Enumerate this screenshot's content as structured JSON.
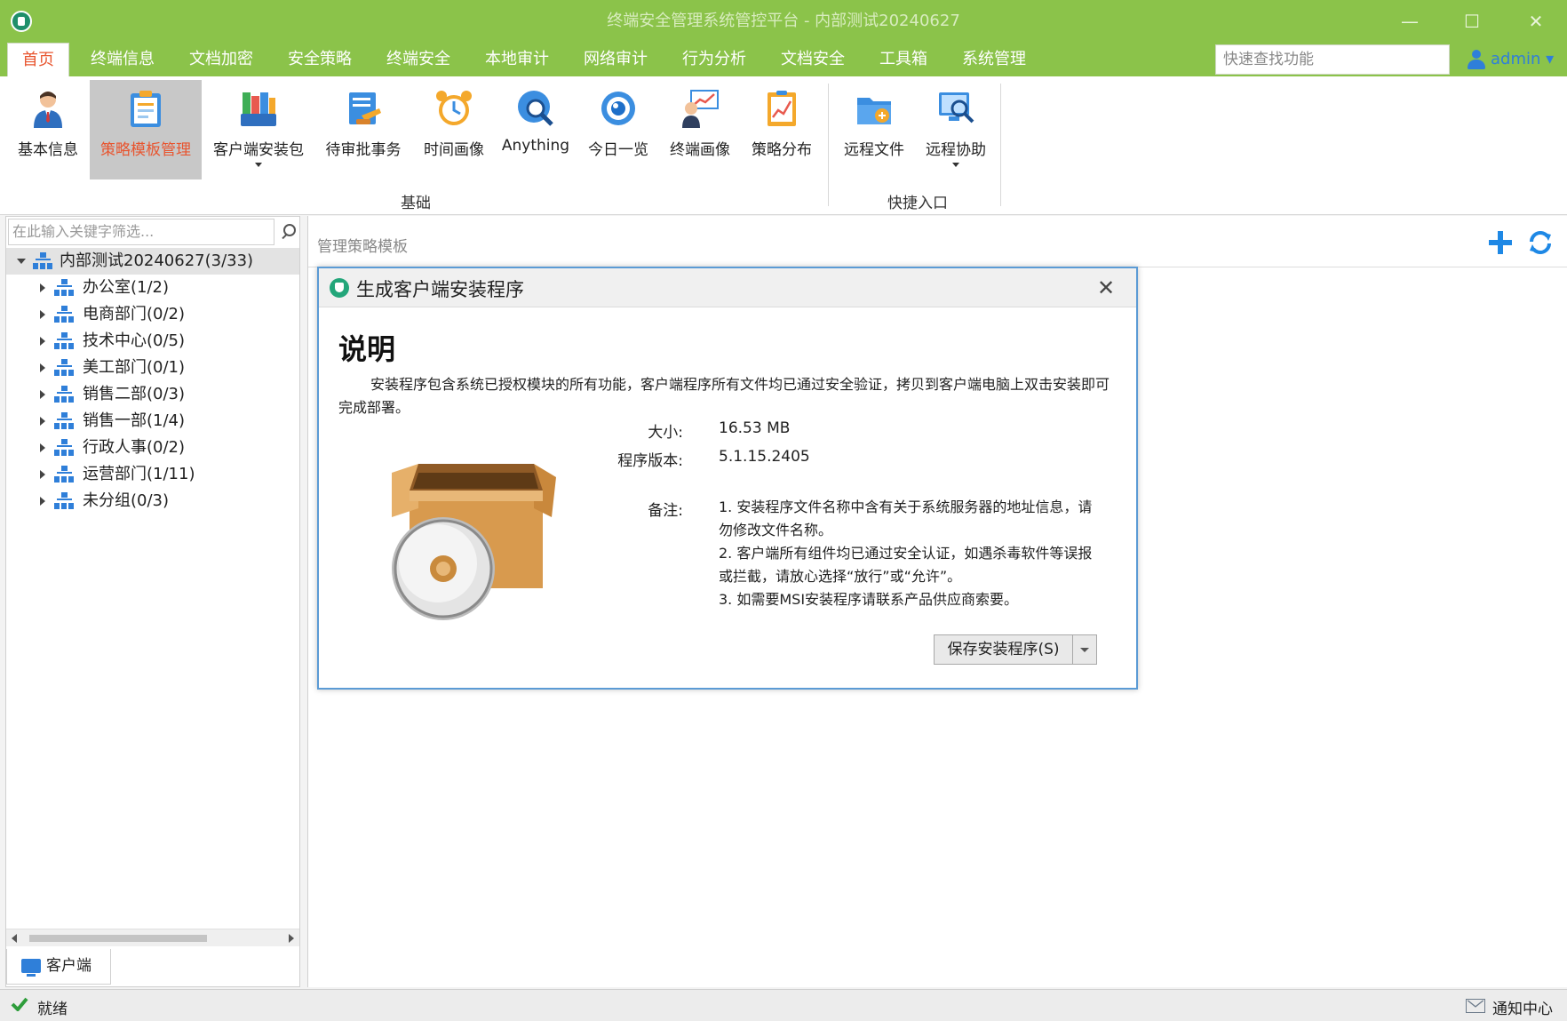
{
  "window": {
    "title": "终端安全管理系统管控平台 - 内部测试20240627",
    "min_glyph": "—",
    "max_glyph": "☐",
    "close_glyph": "✕"
  },
  "menu": {
    "tabs": [
      "首页",
      "终端信息",
      "文档加密",
      "安全策略",
      "终端安全",
      "本地审计",
      "网络审计",
      "行为分析",
      "文档安全",
      "工具箱",
      "系统管理"
    ],
    "active_index": 0,
    "quick_search_placeholder": "快速查找功能",
    "user": "admin ▾"
  },
  "ribbon": {
    "buttons": [
      {
        "label": "基本信息",
        "icon": "person-icon"
      },
      {
        "label": "策略模板管理",
        "icon": "clipboard-icon"
      },
      {
        "label": "客户端安装包",
        "icon": "package-icon"
      },
      {
        "label": "待审批事务",
        "icon": "approval-icon"
      },
      {
        "label": "时间画像",
        "icon": "clock-icon"
      },
      {
        "label": "Anything",
        "icon": "globe-search-icon"
      },
      {
        "label": "今日一览",
        "icon": "eye-icon"
      },
      {
        "label": "终端画像",
        "icon": "user-chart-icon"
      },
      {
        "label": "策略分布",
        "icon": "chart-icon"
      },
      {
        "label": "远程文件",
        "icon": "folder-icon"
      },
      {
        "label": "远程协助",
        "icon": "remote-assist-icon"
      }
    ],
    "groups": [
      "基础",
      "快捷入口"
    ],
    "active_index": 1
  },
  "tree": {
    "filter_placeholder": "在此输入关键字筛选...",
    "root": "内部测试20240627(3/33)",
    "items": [
      "办公室(1/2)",
      "电商部门(0/2)",
      "技术中心(0/5)",
      "美工部门(0/1)",
      "销售二部(0/3)",
      "销售一部(1/4)",
      "行政人事(0/2)",
      "运营部门(1/11)",
      "未分组(0/3)"
    ],
    "bottom_tab": "客户端"
  },
  "content": {
    "title": "管理策略模板"
  },
  "dialog": {
    "title": "生成客户端安装程序",
    "close": "✕",
    "heading": "说明",
    "description": "安装程序包含系统已授权模块的所有功能，客户端程序所有文件均已通过安全验证，拷贝到客户端电脑上双击安装即可完成部署。",
    "size_label": "大小:",
    "size_value": "16.53 MB",
    "version_label": "程序版本:",
    "version_value": "5.1.15.2405",
    "notes_label": "备注:",
    "notes": [
      "1. 安装程序文件名称中含有关于系统服务器的地址信息，请勿修改文件名称。",
      "2. 客户端所有组件均已通过安全认证，如遇杀毒软件等误报或拦截，请放心选择“放行”或“允许”。",
      "3. 如需要MSI安装程序请联系产品供应商索要。"
    ],
    "save_button": "保存安装程序(S)"
  },
  "status": {
    "text": "就绪",
    "notify": "通知中心"
  },
  "colors": {
    "header_green": "#8bc34a",
    "accent_orange": "#e8552f",
    "icon_blue": "#2f7fd9",
    "dialog_border": "#5b9bd5"
  }
}
